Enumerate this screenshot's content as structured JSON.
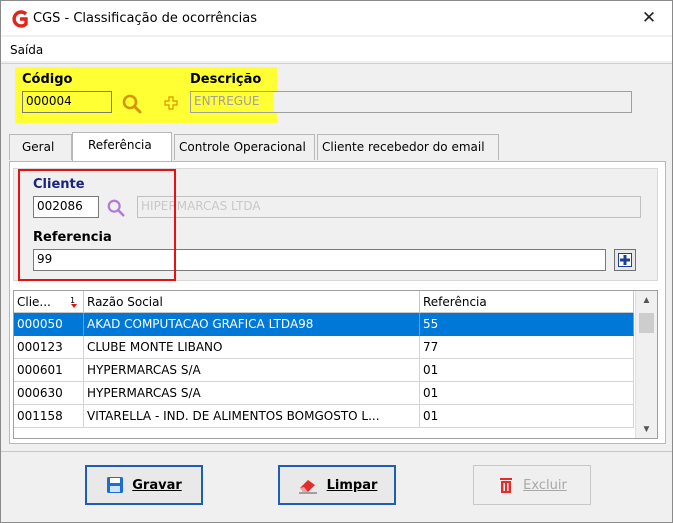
{
  "window": {
    "title": "CGS - Classificação de ocorrências",
    "close_symbol": "✕",
    "app_icon": "cgs-logo-icon",
    "brand_color": "#e0261b"
  },
  "menu": {
    "items": [
      {
        "label": "Saída"
      }
    ]
  },
  "header_fields": {
    "codigo_label": "Código",
    "codigo_value": "000004",
    "descricao_label": "Descrição",
    "descricao_value": "ENTREGUE",
    "highlight_color": "#ffff33"
  },
  "tabs": [
    {
      "label": "Geral",
      "active": false
    },
    {
      "label": "Referência",
      "active": true
    },
    {
      "label": "Controle Operacional",
      "active": false
    },
    {
      "label": "Cliente recebedor do email",
      "active": false
    }
  ],
  "referencia_tab": {
    "cliente_label": "Cliente",
    "cliente_value": "002086",
    "cliente_name": "HIPERMARCAS LTDA",
    "referencia_label": "Referencia",
    "referencia_value": "99",
    "annotation_color": "#e81010"
  },
  "grid": {
    "columns": [
      "Clie...",
      "Razão Social",
      "Referência"
    ],
    "sort_column": "Clie...",
    "sort_indicator": "1↓",
    "rows": [
      {
        "cliente": "000050",
        "razao": "AKAD COMPUTACAO GRAFICA LTDA98",
        "referencia": "55",
        "selected": true
      },
      {
        "cliente": "000123",
        "razao": "CLUBE MONTE LIBANO",
        "referencia": "77",
        "selected": false
      },
      {
        "cliente": "000601",
        "razao": "HYPERMARCAS S/A",
        "referencia": "01",
        "selected": false
      },
      {
        "cliente": "000630",
        "razao": "HYPERMARCAS S/A",
        "referencia": "01",
        "selected": false
      },
      {
        "cliente": "001158",
        "razao": "VITARELLA - IND. DE ALIMENTOS BOMGOSTO L...",
        "referencia": "01",
        "selected": false
      }
    ],
    "selection_color": "#0078d7"
  },
  "buttons": {
    "gravar": {
      "label": "Gravar",
      "icon": "save-disk-icon"
    },
    "limpar": {
      "label": "Limpar",
      "icon": "eraser-icon"
    },
    "excluir": {
      "label": "Excluir",
      "icon": "trash-icon",
      "enabled": false
    }
  }
}
